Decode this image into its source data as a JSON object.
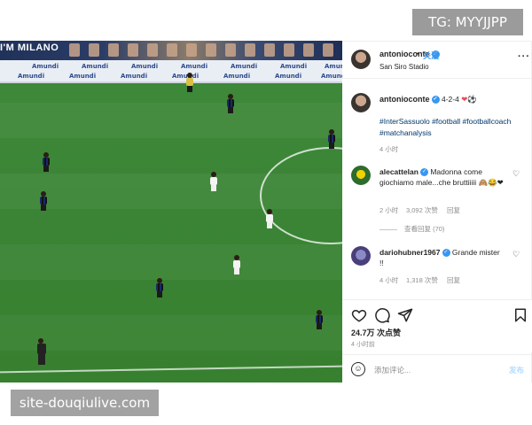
{
  "watermarks": {
    "top": "TG: MYYJJPP",
    "bottom": "site-douqiulive.com"
  },
  "video": {
    "stand_text": "I'M MILANO",
    "board_brand": "Amundi",
    "mute_icon": "speaker-muted-icon"
  },
  "post": {
    "header": {
      "username": "antonioconte",
      "follow_label": "关注",
      "separator": "•",
      "location": "San Siro Stadio",
      "more_icon": "more-horizontal-icon"
    },
    "caption": {
      "username": "antonioconte",
      "text": "4-2-4",
      "emojis": "❤⚽",
      "hashtags": "#InterSassuolo #football #footballcoach #matchanalysis",
      "time": "4 小时"
    },
    "comments": [
      {
        "username": "alecattelan",
        "text": "Madonna come giochiamo male...che bruttiiiii",
        "emojis": "🙈😂❤",
        "time": "2 小时",
        "likes": "3,092 次赞",
        "reply": "回复",
        "view_replies": "查看回复 (70)"
      },
      {
        "username": "dariohubner1967",
        "text": "Grande mister !!",
        "time": "4 小时",
        "likes": "1,318 次赞",
        "reply": "回复"
      }
    ],
    "actions": {
      "likes": "24.7万 次点赞",
      "time_ago": "4 小时前"
    },
    "add_comment": {
      "placeholder": "添加评论...",
      "post_label": "发布"
    }
  },
  "colors": {
    "link": "#00376b",
    "verified": "#3897f0",
    "heart": "#ed4956"
  }
}
